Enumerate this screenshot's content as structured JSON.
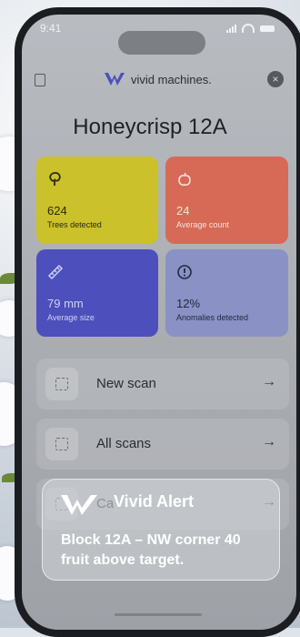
{
  "status": {
    "time": "9:41"
  },
  "brand": {
    "name": "vivid machines."
  },
  "header": {
    "title": "Honeycrisp 12A"
  },
  "cards": [
    {
      "value": "624",
      "label": "Trees detected",
      "icon": "tree-icon",
      "color": "#cbc12a"
    },
    {
      "value": "24",
      "label": "Average count",
      "icon": "apple-icon",
      "color": "#d66a57"
    },
    {
      "value": "79 mm",
      "label": "Average size",
      "icon": "ruler-icon",
      "color": "#4d4fbc"
    },
    {
      "value": "12%",
      "label": "Anomalies detected",
      "icon": "alert-circle-icon",
      "color": "#8a91c4"
    }
  ],
  "actions": [
    {
      "label": "New scan",
      "arrow": "→"
    },
    {
      "label": "All scans",
      "arrow": "→"
    },
    {
      "label": "Ca",
      "arrow": "→"
    }
  ],
  "notification": {
    "title": "Vivid Alert",
    "body": "Block 12A – NW corner 40 fruit above target."
  },
  "close_glyph": "×"
}
